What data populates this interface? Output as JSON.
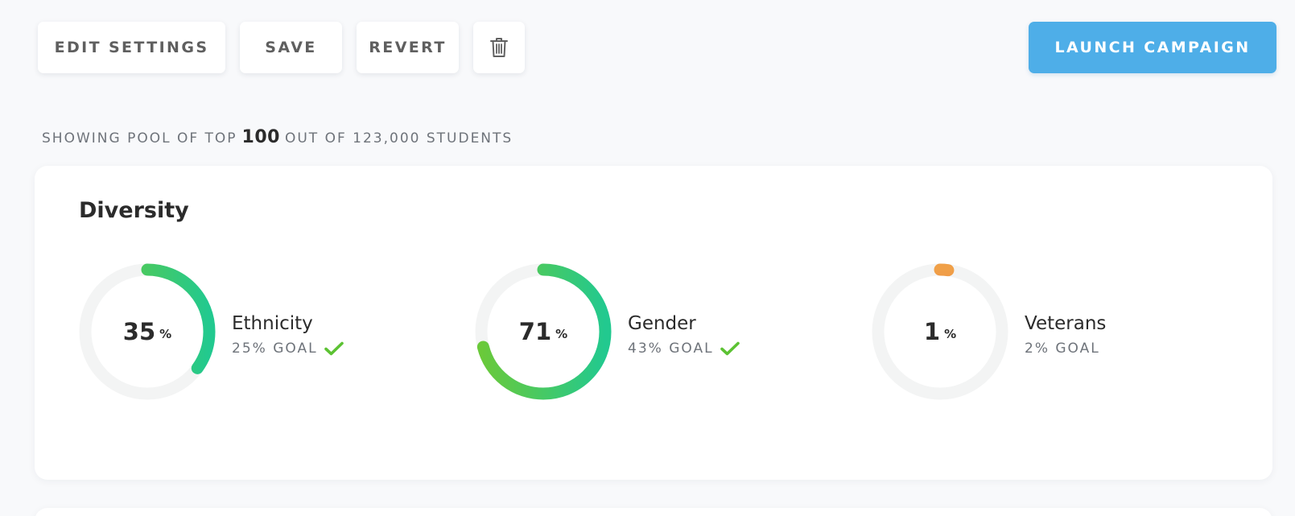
{
  "toolbar": {
    "edit_settings_label": "EDIT SETTINGS",
    "save_label": "SAVE",
    "revert_label": "REVERT",
    "delete_icon": "trash-icon",
    "launch_label": "LAUNCH CAMPAIGN"
  },
  "pool": {
    "prefix": "SHOWING POOL OF TOP",
    "top_count": "100",
    "suffix": "OUT OF 123,000 STUDENTS"
  },
  "diversity": {
    "title": "Diversity",
    "unit": "%",
    "metrics": [
      {
        "key": "ethnicity",
        "label": "Ethnicity",
        "value": 35,
        "value_text": "35",
        "goal_text": "25% GOAL",
        "goal_met": true,
        "gradient": [
          "#22c98f",
          "#6ac93a"
        ]
      },
      {
        "key": "gender",
        "label": "Gender",
        "value": 71,
        "value_text": "71",
        "goal_text": "43% GOAL",
        "goal_met": true,
        "gradient": [
          "#22c98f",
          "#6ac93a"
        ]
      },
      {
        "key": "veterans",
        "label": "Veterans",
        "value": 1,
        "value_text": "1",
        "goal_text": "2% GOAL",
        "goal_met": false,
        "gradient": [
          "#e8504a",
          "#f0a048"
        ]
      }
    ]
  },
  "colors": {
    "accent": "#4eaee8",
    "track": "#f3f4f4",
    "check": "#5cc233",
    "muted_text": "#6e737a",
    "page_background": "#f8f9fb"
  }
}
